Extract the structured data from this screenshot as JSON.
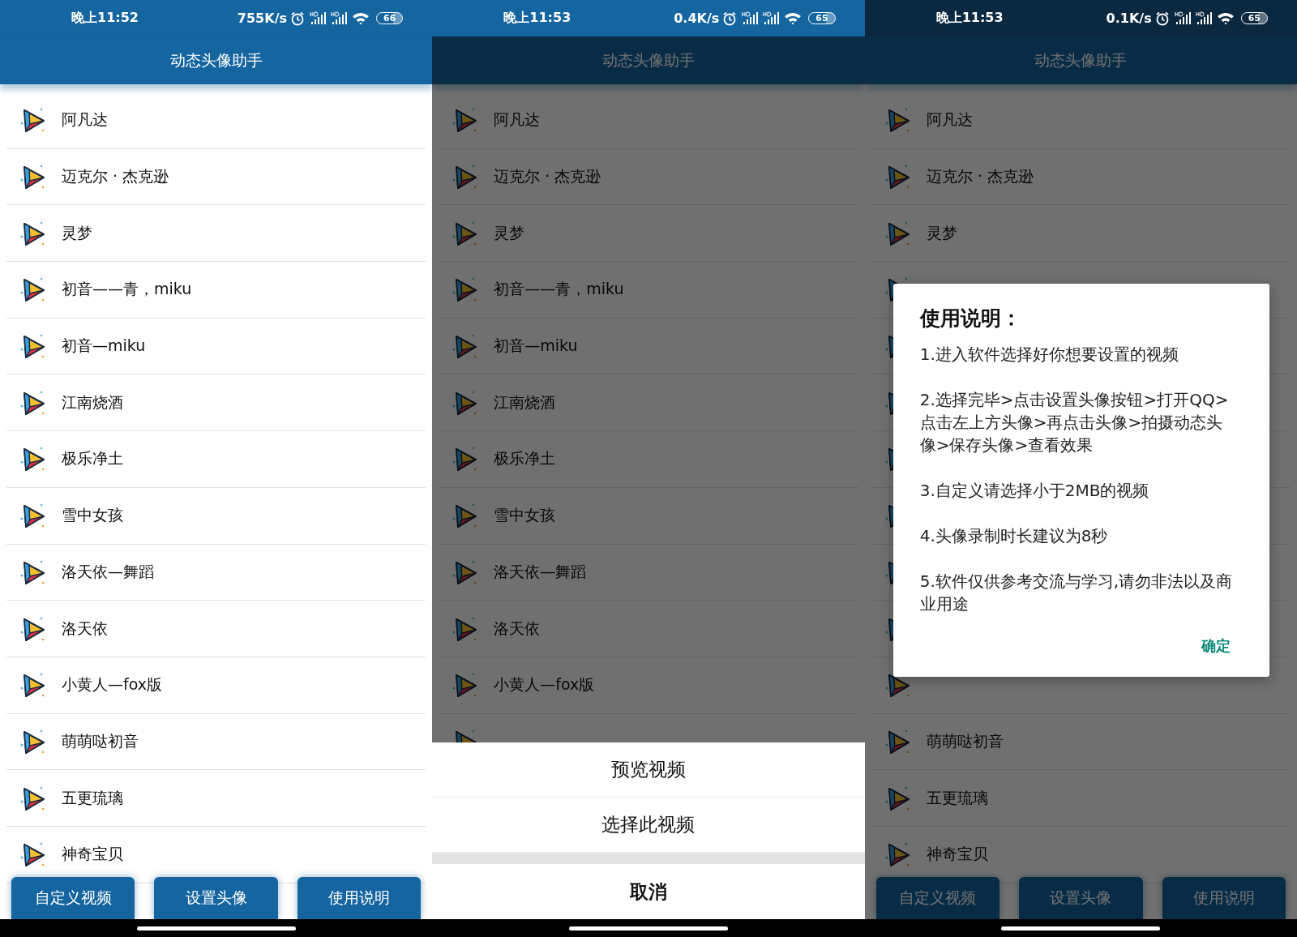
{
  "screens": [
    {
      "status_bar": {
        "time": "晚上11:52",
        "speed": "755K/s",
        "battery": "66",
        "dimmed": false
      },
      "title": "动态头像助手",
      "dimmed": false,
      "list": [
        {
          "label": "阿凡达"
        },
        {
          "label": "迈克尔 · 杰克逊"
        },
        {
          "label": "灵梦"
        },
        {
          "label": "初音——青，miku"
        },
        {
          "label": "初音—miku"
        },
        {
          "label": "江南烧酒"
        },
        {
          "label": "极乐净土"
        },
        {
          "label": "雪中女孩"
        },
        {
          "label": "洛天依—舞蹈"
        },
        {
          "label": "洛天依"
        },
        {
          "label": "小黄人—fox版"
        },
        {
          "label": "萌萌哒初音"
        },
        {
          "label": "五更琉璃"
        },
        {
          "label": "神奇宝贝"
        }
      ],
      "buttons": [
        "自定义视频",
        "设置头像",
        "使用说明"
      ]
    },
    {
      "status_bar": {
        "time": "晚上11:53",
        "speed": "0.4K/s",
        "battery": "65",
        "dimmed": false
      },
      "title": "动态头像助手",
      "dimmed": true,
      "list": [
        {
          "label": "阿凡达"
        },
        {
          "label": "迈克尔 · 杰克逊"
        },
        {
          "label": "灵梦"
        },
        {
          "label": "初音——青，miku"
        },
        {
          "label": "初音—miku"
        },
        {
          "label": "江南烧酒"
        },
        {
          "label": "极乐净土"
        },
        {
          "label": "雪中女孩"
        },
        {
          "label": "洛天依—舞蹈"
        },
        {
          "label": "洛天依"
        },
        {
          "label": "小黄人—fox版"
        },
        {
          "covered": true
        }
      ],
      "action_sheet": {
        "options": [
          "预览视频",
          "选择此视频"
        ],
        "cancel": "取消"
      }
    },
    {
      "status_bar": {
        "time": "晚上11:53",
        "speed": "0.1K/s",
        "battery": "65",
        "dimmed": true
      },
      "title": "动态头像助手",
      "dimmed": true,
      "list": [
        {
          "label": "阿凡达"
        },
        {
          "label": "迈克尔 · 杰克逊"
        },
        {
          "label": "灵梦"
        },
        {
          "covered": true
        },
        {
          "covered": true
        },
        {
          "covered": true
        },
        {
          "covered": true
        },
        {
          "covered": true
        },
        {
          "covered": true
        },
        {
          "covered": true
        },
        {
          "covered": true
        },
        {
          "label": "萌萌哒初音"
        },
        {
          "label": "五更琉璃"
        },
        {
          "label": "神奇宝贝"
        }
      ],
      "buttons": [
        "自定义视频",
        "设置头像",
        "使用说明"
      ],
      "dialog": {
        "title": "使用说明：",
        "paragraphs": [
          "1.进入软件选择好你想要设置的视频",
          "2.选择完毕>点击设置头像按钮>打开QQ>点击左上方头像>再点击头像>拍摄动态头像>保存头像>查看效果",
          "3.自定义请选择小于2MB的视频",
          "4.头像录制时长建议为8秒",
          "5.软件仅供参考交流与学习,请勿非法以及商业用途"
        ],
        "confirm": "确定"
      }
    }
  ]
}
